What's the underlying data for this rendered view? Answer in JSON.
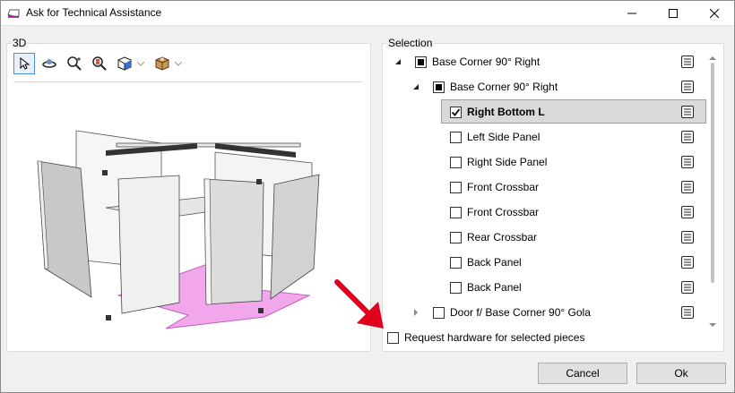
{
  "window": {
    "title": "Ask for Technical Assistance",
    "icon": "app-icon",
    "controls": [
      "minimize-icon",
      "maximize-icon",
      "close-icon"
    ]
  },
  "panel_3d": {
    "label": "3D",
    "tools": [
      "select-pointer-icon",
      "orbit-icon",
      "zoom-fit-icon",
      "zoom-icon",
      "view-cube-icon",
      "box-icon"
    ]
  },
  "selection": {
    "label": "Selection",
    "tree": [
      {
        "label": "Base Corner 90° Right",
        "level": 0,
        "expander": "expanded",
        "check": "partial"
      },
      {
        "label": "Base Corner 90° Right",
        "level": 1,
        "expander": "expanded",
        "check": "partial"
      },
      {
        "label": "Right Bottom L",
        "level": 2,
        "expander": "none",
        "check": "checked",
        "selected": true
      },
      {
        "label": "Left Side Panel",
        "level": 2,
        "expander": "none",
        "check": "unchecked"
      },
      {
        "label": "Right Side Panel",
        "level": 2,
        "expander": "none",
        "check": "unchecked"
      },
      {
        "label": "Front Crossbar",
        "level": 2,
        "expander": "none",
        "check": "unchecked"
      },
      {
        "label": "Front Crossbar",
        "level": 2,
        "expander": "none",
        "check": "unchecked"
      },
      {
        "label": "Rear Crossbar",
        "level": 2,
        "expander": "none",
        "check": "unchecked"
      },
      {
        "label": "Back Panel",
        "level": 2,
        "expander": "none",
        "check": "unchecked"
      },
      {
        "label": "Back Panel",
        "level": 2,
        "expander": "none",
        "check": "unchecked"
      },
      {
        "label": "Door f/ Base Corner 90° Gola",
        "level": 1,
        "expander": "collapsed",
        "check": "unchecked"
      }
    ]
  },
  "request_hardware": {
    "label": "Request hardware for selected pieces",
    "checked": false
  },
  "buttons": {
    "cancel": "Cancel",
    "ok": "Ok"
  },
  "colors": {
    "selected_row": "#d9d9d9",
    "floor_highlight": "#f2a6ec",
    "arrow": "#e0001b"
  }
}
